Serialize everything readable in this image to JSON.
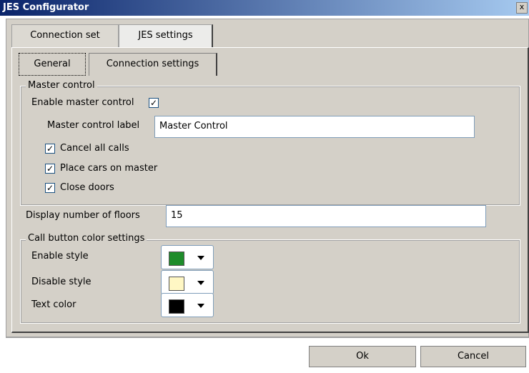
{
  "window": {
    "title": "JES Configurator",
    "close_label": "x"
  },
  "outer_tabs": [
    "Connection set",
    "JES settings"
  ],
  "inner_tabs": [
    "General",
    "Connection settings"
  ],
  "master_control": {
    "group_label": "Master control",
    "enable_label": "Enable master control",
    "enable_checked": true,
    "label_caption": "Master control label",
    "label_value": "Master Control",
    "options": [
      {
        "label": "Cancel all calls",
        "checked": true
      },
      {
        "label": "Place cars on master",
        "checked": true
      },
      {
        "label": "Close doors",
        "checked": true
      }
    ]
  },
  "floors": {
    "label": "Display number of floors",
    "value": "15"
  },
  "call_button": {
    "group_label": "Call button color settings",
    "rows": [
      {
        "label": "Enable style",
        "color": "#1e8c2a",
        "icon": "chevron-down-icon"
      },
      {
        "label": "Disable style",
        "color": "#fff7c4",
        "icon": "chevron-down-icon"
      },
      {
        "label": "Text color",
        "color": "#000000",
        "icon": "chevron-down-icon"
      }
    ]
  },
  "buttons": {
    "ok": "Ok",
    "cancel": "Cancel"
  },
  "colors": {
    "dialog_bg": "#d4d0c8",
    "title_bg": "#0a246a"
  }
}
